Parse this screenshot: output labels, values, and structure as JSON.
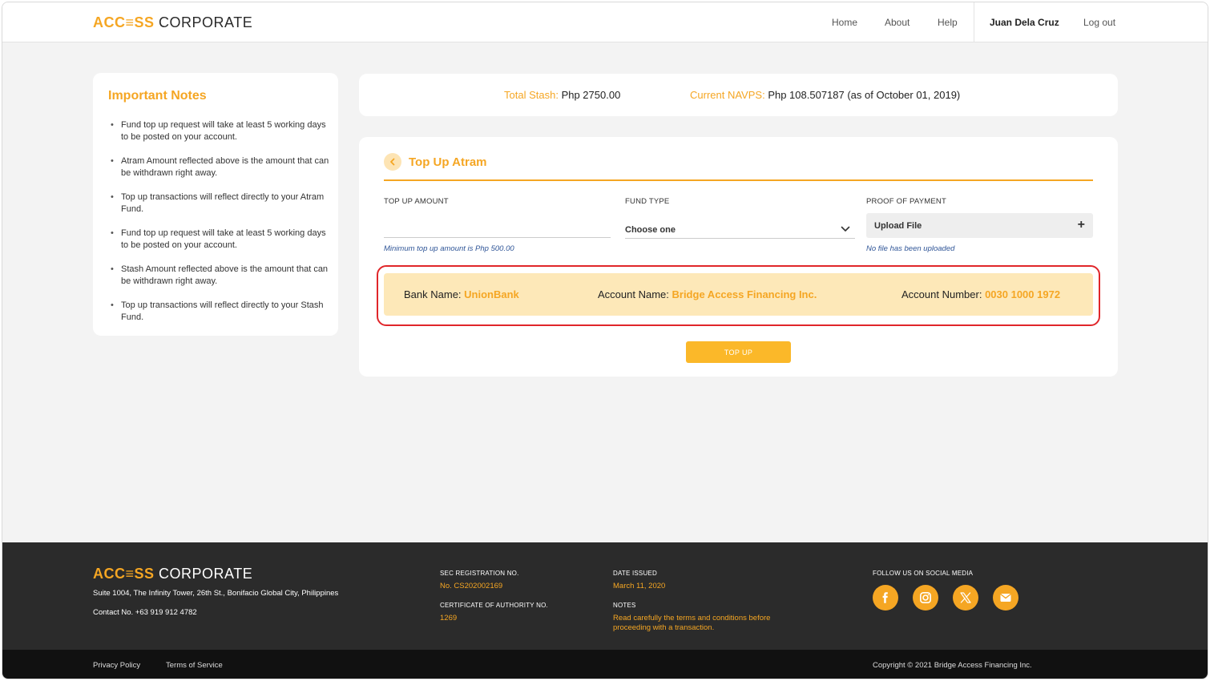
{
  "header": {
    "logo_part1": "ACC≡SS",
    "logo_part2": "CORPORATE",
    "nav": {
      "home": "Home",
      "about": "About",
      "help": "Help"
    },
    "user_name": "Juan Dela Cruz",
    "logout": "Log out"
  },
  "notes": {
    "title": "Important Notes",
    "items": [
      "Fund top up request will take at least 5 working days to be posted on your account.",
      "Atram Amount reflected above is the amount that can be withdrawn right away.",
      "Top up transactions will reflect directly to your Atram Fund.",
      "Fund top up request will take at least 5 working days to be posted on your account.",
      "Stash Amount reflected above is the amount that can be withdrawn right away.",
      "Top up transactions will reflect directly to your Stash Fund."
    ]
  },
  "stash": {
    "total_label": "Total Stash:",
    "total_value": "Php 2750.00",
    "navps_label": "Current NAVPS:",
    "navps_value": "Php 108.507187 (as of October 01, 2019)"
  },
  "form": {
    "title": "Top Up Atram",
    "amount_label": "TOP UP AMOUNT",
    "amount_value": "",
    "amount_hint": "Minimum top up amount is Php 500.00",
    "fund_label": "FUND TYPE",
    "fund_value": "Choose one",
    "proof_label": "PROOF OF PAYMENT",
    "upload_label": "Upload File",
    "upload_plus": "+",
    "upload_hint": "No file has been uploaded",
    "submit": "TOP UP"
  },
  "bank": {
    "bank_name_label": "Bank Name:",
    "bank_name_value": "UnionBank",
    "account_name_label": "Account Name:",
    "account_name_value": "Bridge Access Financing Inc.",
    "account_number_label": "Account Number:",
    "account_number_value": "0030 1000 1972"
  },
  "footer": {
    "address": "Suite 1004, The Infinity Tower, 26th St., Bonifacio Global City, Philippines",
    "contact": "Contact No. +63 919 912 4782",
    "sec_label": "SEC REGISTRATION NO.",
    "sec_value": "No. CS202002169",
    "cert_label": "CERTIFICATE OF AUTHORITY NO.",
    "cert_value": "1269",
    "date_label": "DATE ISSUED",
    "date_value": "March 11, 2020",
    "notes_label": "NOTES",
    "notes_value": "Read carefully the terms and conditions before proceeding with a transaction.",
    "social_label": "FOLLOW US ON SOCIAL MEDIA",
    "social_icons": [
      "facebook-icon",
      "instagram-icon",
      "x-icon",
      "email-icon"
    ],
    "privacy": "Privacy Policy",
    "terms": "Terms of Service",
    "copyright": "Copyright © 2021 Bridge Access Financing Inc."
  },
  "colors": {
    "accent": "#f5a623",
    "button": "#fbb829",
    "bank_bg": "#fde8b8",
    "highlight_outline": "#e0262a",
    "hint_blue": "#2f5597",
    "footer_bg": "#2b2b2b",
    "bottom_bar": "#111111"
  }
}
